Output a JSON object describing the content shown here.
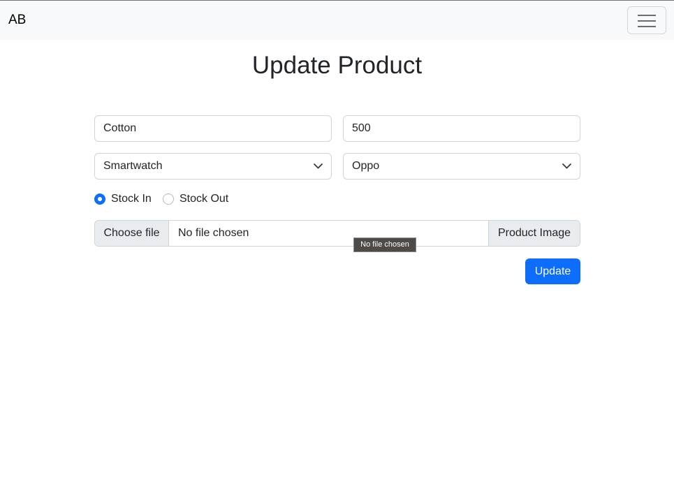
{
  "navbar": {
    "brand": "AB",
    "toggler_icon": "hamburger-icon"
  },
  "page": {
    "title": "Update Product"
  },
  "form": {
    "name_value": "Cotton",
    "price_value": "500",
    "category_selected": "Smartwatch",
    "brand_selected": "Oppo",
    "stock_options": [
      {
        "label": "Stock In",
        "checked": true
      },
      {
        "label": "Stock Out",
        "checked": false
      }
    ],
    "file": {
      "button_label": "Choose file",
      "status": "No file chosen",
      "addon_label": "Product Image",
      "tooltip": "No file chosen"
    },
    "submit_label": "Update"
  },
  "colors": {
    "primary": "#0d6efd",
    "navbar_bg": "#f8f9fa",
    "border": "#ced4da"
  }
}
